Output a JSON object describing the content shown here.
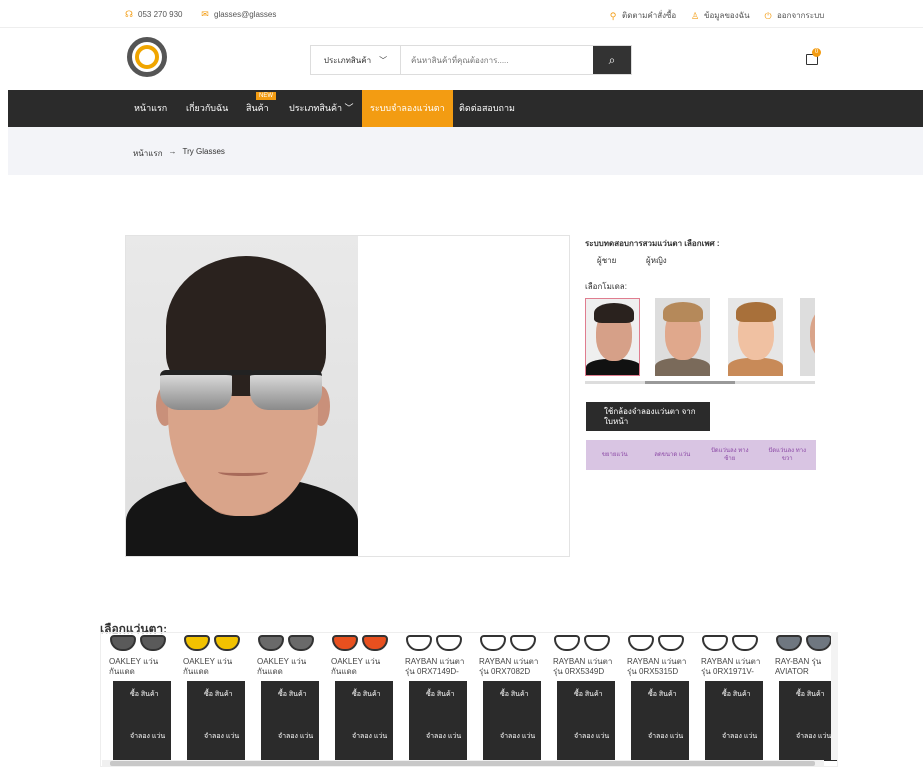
{
  "topbar": {
    "phone": "053 270 930",
    "email": "glasses@glasses",
    "track_order": "ติดตามคำสั่งซื้อ",
    "account": "ข้อมูลของฉัน",
    "logout": "ออกจากระบบ"
  },
  "header": {
    "search_category": "ประเภทสินค้า",
    "search_placeholder": "ค้นหาสินค้าที่คุณต้องการ.....",
    "cart_count": "0"
  },
  "nav": {
    "items": [
      {
        "label": "หน้าแรก"
      },
      {
        "label": "เกี่ยวกับฉัน"
      },
      {
        "label": "สินค้า"
      },
      {
        "label": "ประเภทสินค้า ﹀"
      },
      {
        "label": "ระบบจำลองแว่นตา"
      },
      {
        "label": "ติดต่อสอบถาม"
      }
    ],
    "new_badge": "NEW"
  },
  "breadcrumb": {
    "home": "หน้าแรก",
    "separator": "→",
    "current": "Try Glasses"
  },
  "tryon": {
    "title": "ระบบทดสอบการสวมแว่นตา เลือกเพศ :",
    "gender_male": "ผู้ชาย",
    "gender_female": "ผู้หญิง",
    "model_title": "เลือกโมเดล:",
    "camera_button": "ใช้กล้องจำลองแว่นตา จากใบหน้า",
    "controls": [
      "ขยายแว่น",
      "ลดขนาด แว่น",
      "ปัดแว่นลง ทางซ้าย",
      "ปัดแว่นลง ทางขวา"
    ]
  },
  "glasses": {
    "title": "เลือกแว่นตา:",
    "buy_label": "ซื้อ สินค้า",
    "try_label": "จำลอง แว่น",
    "items": [
      {
        "name": "OAKLEY แว่นกันแดด",
        "color": "#5a5a5a"
      },
      {
        "name": "OAKLEY แว่นกันแดด",
        "color": "#f2c200"
      },
      {
        "name": "OAKLEY แว่นกันแดด",
        "color": "#6a6a6a"
      },
      {
        "name": "OAKLEY แว่นกันแดด",
        "color": "#e8501f"
      },
      {
        "name": "RAYBAN แว่นตา รุ่น 0RX7149D-",
        "color": "#ffffff"
      },
      {
        "name": "RAYBAN แว่นตา รุ่น 0RX7082D",
        "color": "#ffffff"
      },
      {
        "name": "RAYBAN แว่นตา รุ่น 0RX5349D",
        "color": "#ffffff"
      },
      {
        "name": "RAYBAN แว่นตา รุ่น 0RX5315D",
        "color": "#ffffff"
      },
      {
        "name": "RAYBAN แว่นตา รุ่น 0RX1971V-",
        "color": "#ffffff"
      },
      {
        "name": "RAY-BAN รุ่น AVIATOR",
        "color": "#6f7780"
      }
    ]
  }
}
